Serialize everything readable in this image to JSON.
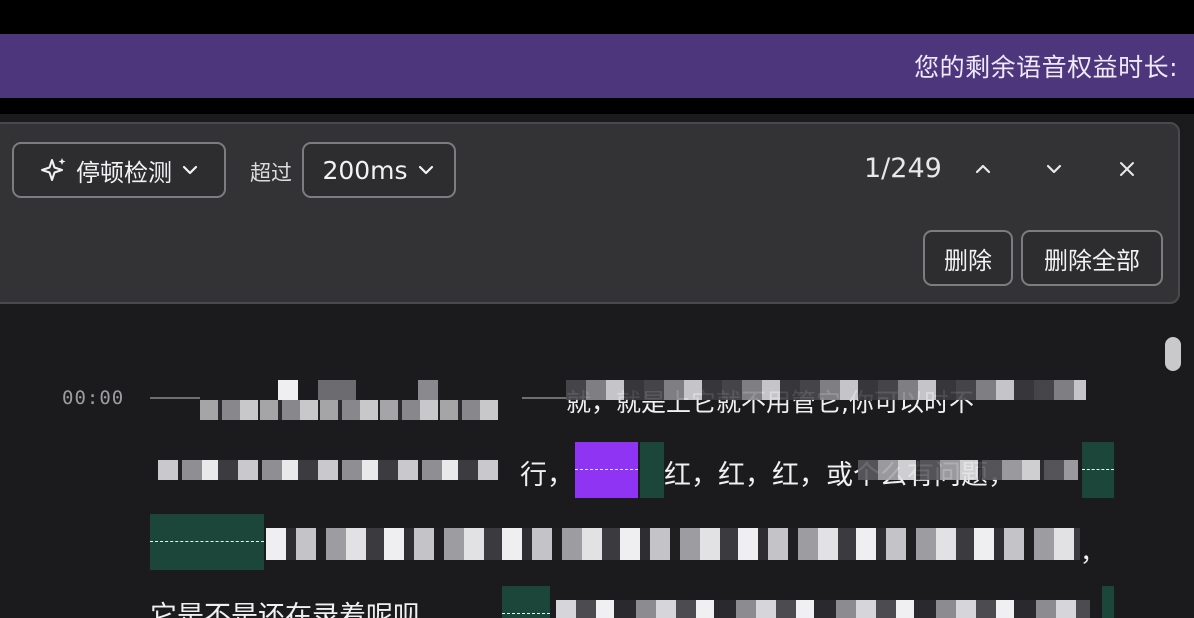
{
  "banner": {
    "text": "您的剩余语音权益时长:",
    "background": "#4d367c"
  },
  "toolbar": {
    "mode_label": "停顿检测",
    "mode_icon": "sparkle-icon",
    "over_label": "超过",
    "threshold_label": "200ms",
    "counter": "1/249",
    "prev_icon": "chevron-up-icon",
    "next_icon": "chevron-down-icon",
    "close_icon": "close-icon",
    "delete_label": "删除",
    "delete_all_label": "删除全部"
  },
  "transcript": {
    "timestamp": "00:00",
    "lines": [
      {
        "text": "就，就是上它就不用管它,你可以时不"
      },
      {
        "text": "行，"
      },
      {
        "text": "红，红，红，或个么有问题，"
      },
      {
        "text": "，"
      },
      {
        "text": "它是不是还在录着呢呗"
      }
    ]
  },
  "colors": {
    "pause_active": "#8e34f2",
    "pause_inactive": "#1b4639",
    "panel": "#333336"
  }
}
